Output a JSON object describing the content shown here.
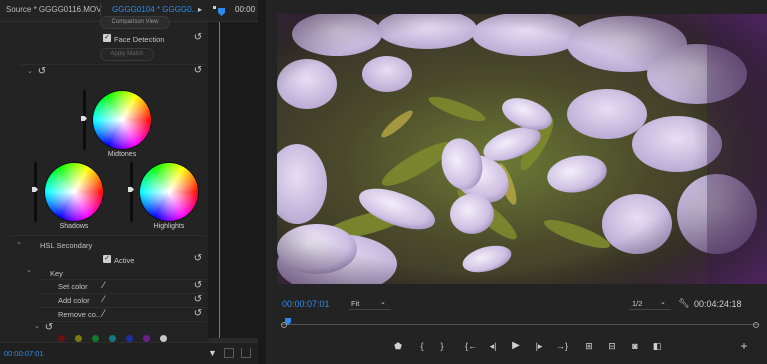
{
  "source_panel": {
    "tab_source": "Source * GGGG0116.MOV",
    "tab_active": "GGGG0104 * GGGG0...",
    "tab_arrow": "▸",
    "timeline_timecode": "00:00"
  },
  "lumetri": {
    "comparison_view_label": "Comparison View",
    "face_detection_label": "Face Detection",
    "face_detection_checked": true,
    "apply_match_label": "Apply Match",
    "wheels": {
      "midtones": "Midtones",
      "shadows": "Shadows",
      "highlights": "Highlights"
    },
    "hsl_secondary_label": "HSL Secondary",
    "active_label": "Active",
    "active_checked": true,
    "key_label": "Key",
    "set_color_label": "Set color",
    "add_color_label": "Add color",
    "remove_color_label": "Remove co...",
    "color_dots": [
      "#6b1212",
      "#7a7a10",
      "#127a2a",
      "#137b7b",
      "#1d2fa3",
      "#6e1f8a",
      "#c7c7c7"
    ]
  },
  "left_bottom": {
    "timecode": "00:00:07:01"
  },
  "program": {
    "current_timecode": "00:00:07:01",
    "fit_label": "Fit",
    "resolution_label": "1/2",
    "duration_timecode": "00:04:24:18"
  },
  "colors": {
    "accent": "#2d8ceb",
    "playhead": "#2d8ceb"
  }
}
